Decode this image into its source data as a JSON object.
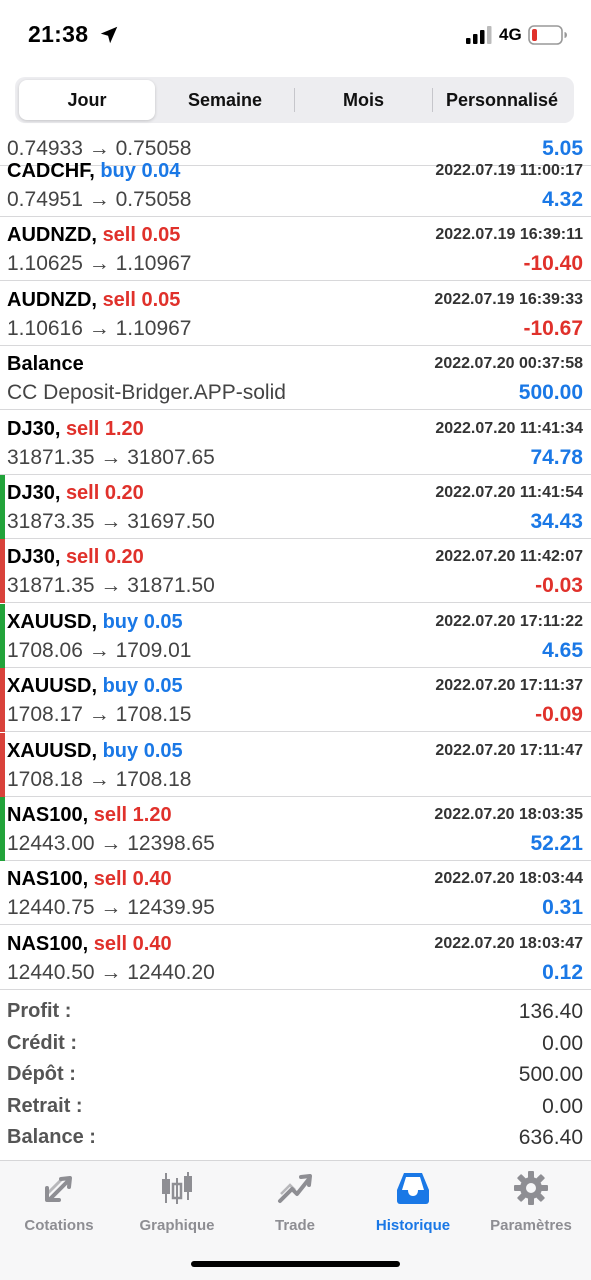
{
  "status": {
    "time": "21:38",
    "network": "4G"
  },
  "segment": {
    "tabs": [
      "Jour",
      "Semaine",
      "Mois",
      "Personnalisé"
    ],
    "active": 0
  },
  "colors": {
    "buy": "#1a78e6",
    "sell": "#e0312b",
    "profit": "#1a78e6",
    "loss": "#e0312b",
    "win_bar": "#22a33a",
    "loss_bar": "#d9423b"
  },
  "partial_row": {
    "prices": "0.74933 → 0.75058",
    "pl": "5.05"
  },
  "rows": [
    {
      "symbol": "CADCHF,",
      "action": "buy 0.04",
      "side": "buy",
      "date": "2022.07.19 11:00:17",
      "prices": "0.74951 → 0.75058",
      "pl": "4.32",
      "sign": "pos",
      "bar": ""
    },
    {
      "symbol": "AUDNZD,",
      "action": "sell 0.05",
      "side": "sell",
      "date": "2022.07.19 16:39:11",
      "prices": "1.10625 → 1.10967",
      "pl": "-10.40",
      "sign": "neg",
      "bar": ""
    },
    {
      "symbol": "AUDNZD,",
      "action": "sell 0.05",
      "side": "sell",
      "date": "2022.07.19 16:39:33",
      "prices": "1.10616 → 1.10967",
      "pl": "-10.67",
      "sign": "neg",
      "bar": ""
    },
    {
      "symbol": "Balance",
      "action": "",
      "side": "",
      "date": "2022.07.20 00:37:58",
      "prices": "CC Deposit-Bridger.APP-solid",
      "pl": "500.00",
      "sign": "pos",
      "bar": ""
    },
    {
      "symbol": "DJ30,",
      "action": "sell 1.20",
      "side": "sell",
      "date": "2022.07.20 11:41:34",
      "prices": "31871.35 → 31807.65",
      "pl": "74.78",
      "sign": "pos",
      "bar": ""
    },
    {
      "symbol": "DJ30,",
      "action": "sell 0.20",
      "side": "sell",
      "date": "2022.07.20 11:41:54",
      "prices": "31873.35 → 31697.50",
      "pl": "34.43",
      "sign": "pos",
      "bar": "win"
    },
    {
      "symbol": "DJ30,",
      "action": "sell 0.20",
      "side": "sell",
      "date": "2022.07.20 11:42:07",
      "prices": "31871.35 → 31871.50",
      "pl": "-0.03",
      "sign": "neg",
      "bar": "loss"
    },
    {
      "symbol": "XAUUSD,",
      "action": "buy 0.05",
      "side": "buy",
      "date": "2022.07.20 17:11:22",
      "prices": "1708.06 → 1709.01",
      "pl": "4.65",
      "sign": "pos",
      "bar": "win"
    },
    {
      "symbol": "XAUUSD,",
      "action": "buy 0.05",
      "side": "buy",
      "date": "2022.07.20 17:11:37",
      "prices": "1708.17 → 1708.15",
      "pl": "-0.09",
      "sign": "neg",
      "bar": "loss"
    },
    {
      "symbol": "XAUUSD,",
      "action": "buy 0.05",
      "side": "buy",
      "date": "2022.07.20 17:11:47",
      "prices": "1708.18 → 1708.18",
      "pl": "",
      "sign": "pos",
      "bar": "loss"
    },
    {
      "symbol": "NAS100,",
      "action": "sell 1.20",
      "side": "sell",
      "date": "2022.07.20 18:03:35",
      "prices": "12443.00 → 12398.65",
      "pl": "52.21",
      "sign": "pos",
      "bar": "win"
    },
    {
      "symbol": "NAS100,",
      "action": "sell 0.40",
      "side": "sell",
      "date": "2022.07.20 18:03:44",
      "prices": "12440.75 → 12439.95",
      "pl": "0.31",
      "sign": "pos",
      "bar": ""
    },
    {
      "symbol": "NAS100,",
      "action": "sell 0.40",
      "side": "sell",
      "date": "2022.07.20 18:03:47",
      "prices": "12440.50 → 12440.20",
      "pl": "0.12",
      "sign": "pos",
      "bar": ""
    }
  ],
  "summary": [
    {
      "label": "Profit :",
      "value": "136.40"
    },
    {
      "label": "Crédit :",
      "value": "0.00"
    },
    {
      "label": "Dépôt :",
      "value": "500.00"
    },
    {
      "label": "Retrait :",
      "value": "0.00"
    },
    {
      "label": "Balance :",
      "value": "636.40"
    }
  ],
  "tabbar": [
    {
      "label": "Cotations",
      "icon": "quotes-arrows-icon"
    },
    {
      "label": "Graphique",
      "icon": "candlestick-chart-icon"
    },
    {
      "label": "Trade",
      "icon": "trade-trend-icon"
    },
    {
      "label": "Historique",
      "icon": "inbox-tray-icon"
    },
    {
      "label": "Paramètres",
      "icon": "gear-icon"
    }
  ],
  "active_tab": 3
}
